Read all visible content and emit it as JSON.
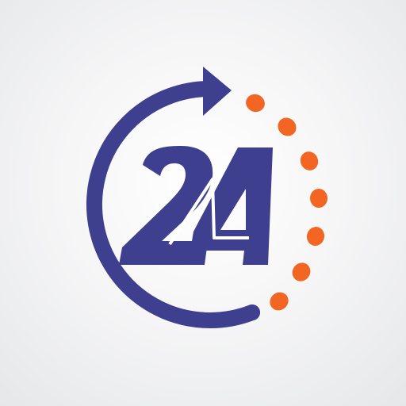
{
  "logo": {
    "text": "24",
    "icon": "24-hour-clock-arrow-icon",
    "colors": {
      "primary": "#3f3f8f",
      "accent": "#f26522",
      "background": "#f1f1f2"
    }
  }
}
